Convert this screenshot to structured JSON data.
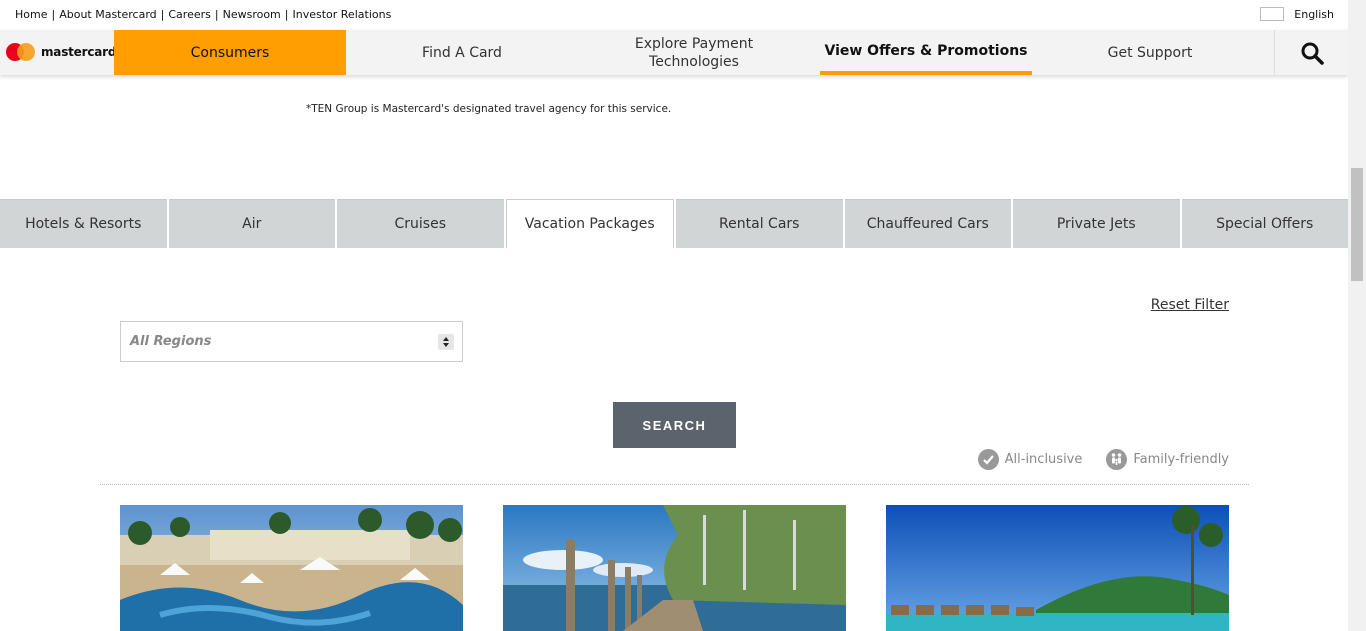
{
  "utility": {
    "links": [
      "Home",
      "About Mastercard",
      "Careers",
      "Newsroom",
      "Investor Relations"
    ],
    "language": "English"
  },
  "brand": {
    "name": "mastercard"
  },
  "nav": {
    "consumers": "Consumers",
    "find_card": "Find A Card",
    "explore_line1": "Explore Payment",
    "explore_line2": "Technologies",
    "offers": "View Offers & Promotions",
    "support": "Get Support"
  },
  "note": "*TEN Group is Mastercard's designated travel agency for this service.",
  "tabs": [
    "Hotels & Resorts",
    "Air",
    "Cruises",
    "Vacation Packages",
    "Rental Cars",
    "Chauffeured Cars",
    "Private Jets",
    "Special Offers"
  ],
  "active_tab": "Vacation Packages",
  "filter": {
    "reset_label": "Reset Filter",
    "region_selected": "All Regions",
    "search_label": "SEARCH"
  },
  "legend": {
    "all_inclusive": "All-inclusive",
    "family_friendly": "Family-friendly"
  },
  "colors": {
    "accent": "#ff9e00",
    "button": "#5b646d",
    "tab_bg": "#d2d5d5"
  }
}
